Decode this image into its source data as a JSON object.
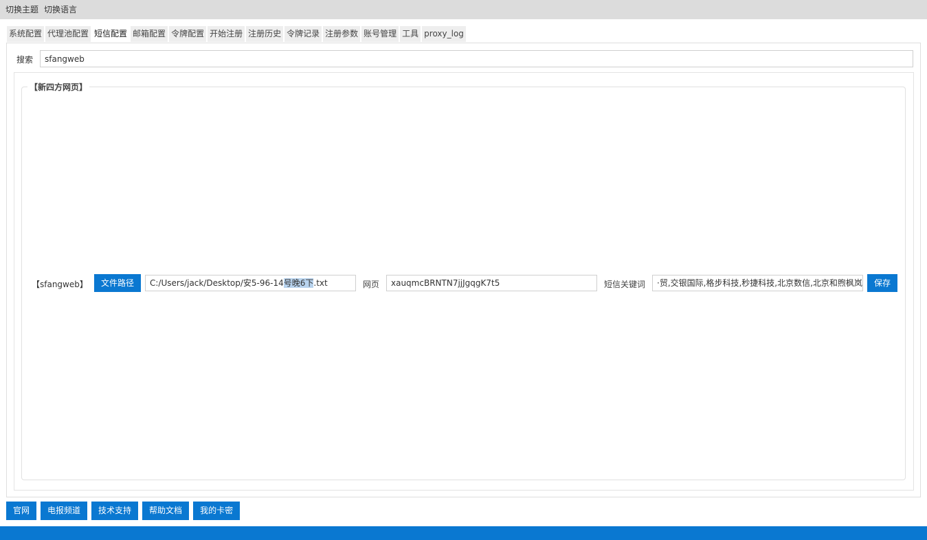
{
  "menu": {
    "switch_theme": "切换主题",
    "switch_language": "切换语言"
  },
  "tabs": [
    {
      "label": "系统配置"
    },
    {
      "label": "代理池配置"
    },
    {
      "label": "短信配置"
    },
    {
      "label": "邮箱配置"
    },
    {
      "label": "令牌配置"
    },
    {
      "label": "开始注册"
    },
    {
      "label": "注册历史"
    },
    {
      "label": "令牌记录"
    },
    {
      "label": "注册参数"
    },
    {
      "label": "账号管理"
    },
    {
      "label": "工具"
    },
    {
      "label": "proxy_log"
    }
  ],
  "active_tab": "短信配置",
  "search": {
    "label": "搜索",
    "value": "sfangweb"
  },
  "group": {
    "title": "【新四方网页】",
    "row": {
      "label": "【sfangweb】",
      "file_path_button": "文件路径",
      "file_path_pre": "C:/Users/jack/Desktop/安5-96-14",
      "file_path_selected": "号晚6下",
      "file_path_post": ".txt",
      "web_label": "网页",
      "web_value": "xauqmcBRNTN7jjJgqgK7t5",
      "keyword_label": "短信关键词",
      "keyword_value": "·贸,交银国际,格步科技,秒捷科技,北京数信,北京和煦枫岚",
      "save_button": "保存"
    }
  },
  "bottom_buttons": [
    {
      "label": "官网"
    },
    {
      "label": "电报频道"
    },
    {
      "label": "技术支持"
    },
    {
      "label": "帮助文档"
    },
    {
      "label": "我的卡密"
    }
  ],
  "colors": {
    "accent": "#0a78d1",
    "menubar": "#dcdcdc",
    "selection": "#b8d3ee"
  }
}
